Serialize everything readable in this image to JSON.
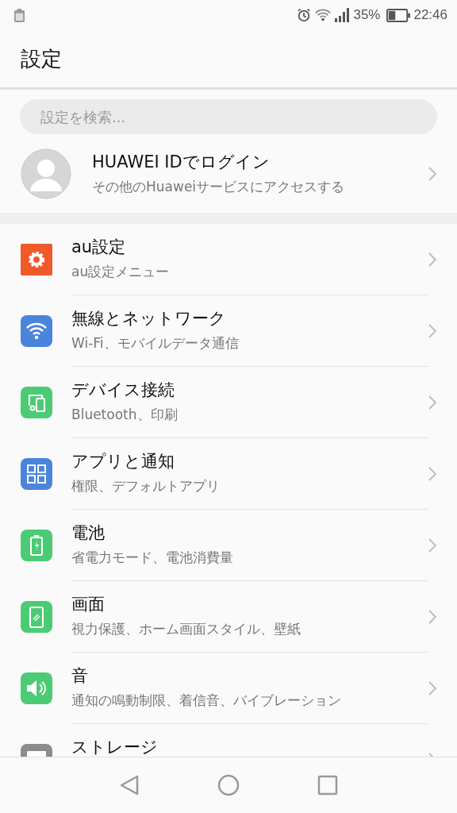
{
  "status_bar": {
    "battery_text": "35%",
    "time": "22:46"
  },
  "title": "設定",
  "search": {
    "placeholder": "設定を検索..."
  },
  "account": {
    "title": "HUAWEI IDでログイン",
    "subtitle": "その他のHuaweiサービスにアクセスする"
  },
  "items": [
    {
      "kind": "gear",
      "color": "#f05a28",
      "title": "au設定",
      "subtitle": "au設定メニュー"
    },
    {
      "kind": "wifi",
      "color": "#4a85db",
      "title": "無線とネットワーク",
      "subtitle": "Wi-Fi、モバイルデータ通信"
    },
    {
      "kind": "devices",
      "color": "#4ccb75",
      "title": "デバイス接続",
      "subtitle": "Bluetooth、印刷"
    },
    {
      "kind": "apps",
      "color": "#4a85db",
      "title": "アプリと通知",
      "subtitle": "権限、デフォルトアプリ"
    },
    {
      "kind": "battery",
      "color": "#4ccb75",
      "title": "電池",
      "subtitle": "省電力モード、電池消費量"
    },
    {
      "kind": "screen",
      "color": "#4ccb75",
      "title": "画面",
      "subtitle": "視力保護、ホーム画面スタイル、壁紙"
    },
    {
      "kind": "sound",
      "color": "#4ccb75",
      "title": "音",
      "subtitle": "通知の鳴動制限、着信音、バイブレーション"
    },
    {
      "kind": "storage",
      "color": "#8c8c8c",
      "title": "ストレージ"
    }
  ]
}
